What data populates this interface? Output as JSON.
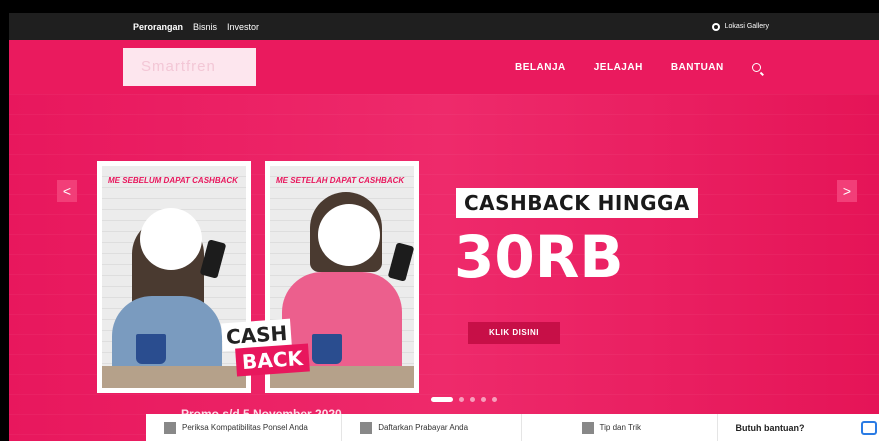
{
  "topbar": {
    "links": [
      "Perorangan",
      "Bisnis",
      "Investor"
    ],
    "location_label": "Lokasi Gallery"
  },
  "header": {
    "logo_text": "Smartfren",
    "nav": [
      "BELANJA",
      "JELAJAH",
      "BANTUAN"
    ]
  },
  "banner": {
    "before_caption": "ME SEBELUM DAPAT CASHBACK",
    "after_caption": "ME SETELAH DAPAT CASHBACK",
    "cash": "CASH",
    "back": "BACK",
    "headline": "CASHBACK HINGGA",
    "amount": "30RB",
    "cta": "KLIK DISINI",
    "promo": "Promo s/d 5 November 2020",
    "prev": "<",
    "next": ">",
    "slide_count": 5,
    "active_slide": 1
  },
  "bottombar": {
    "items": [
      {
        "label": "Periksa Kompatibilitas Ponsel Anda",
        "icon": "phone-check-icon"
      },
      {
        "label": "Daftarkan Prabayar Anda",
        "icon": "register-card-icon"
      },
      {
        "label": "Tip dan Trik",
        "icon": "lightbulb-icon"
      }
    ],
    "help": "Butuh bantuan?"
  },
  "colors": {
    "brand": "#e8175d",
    "dark_bar": "#1f1f1f"
  }
}
